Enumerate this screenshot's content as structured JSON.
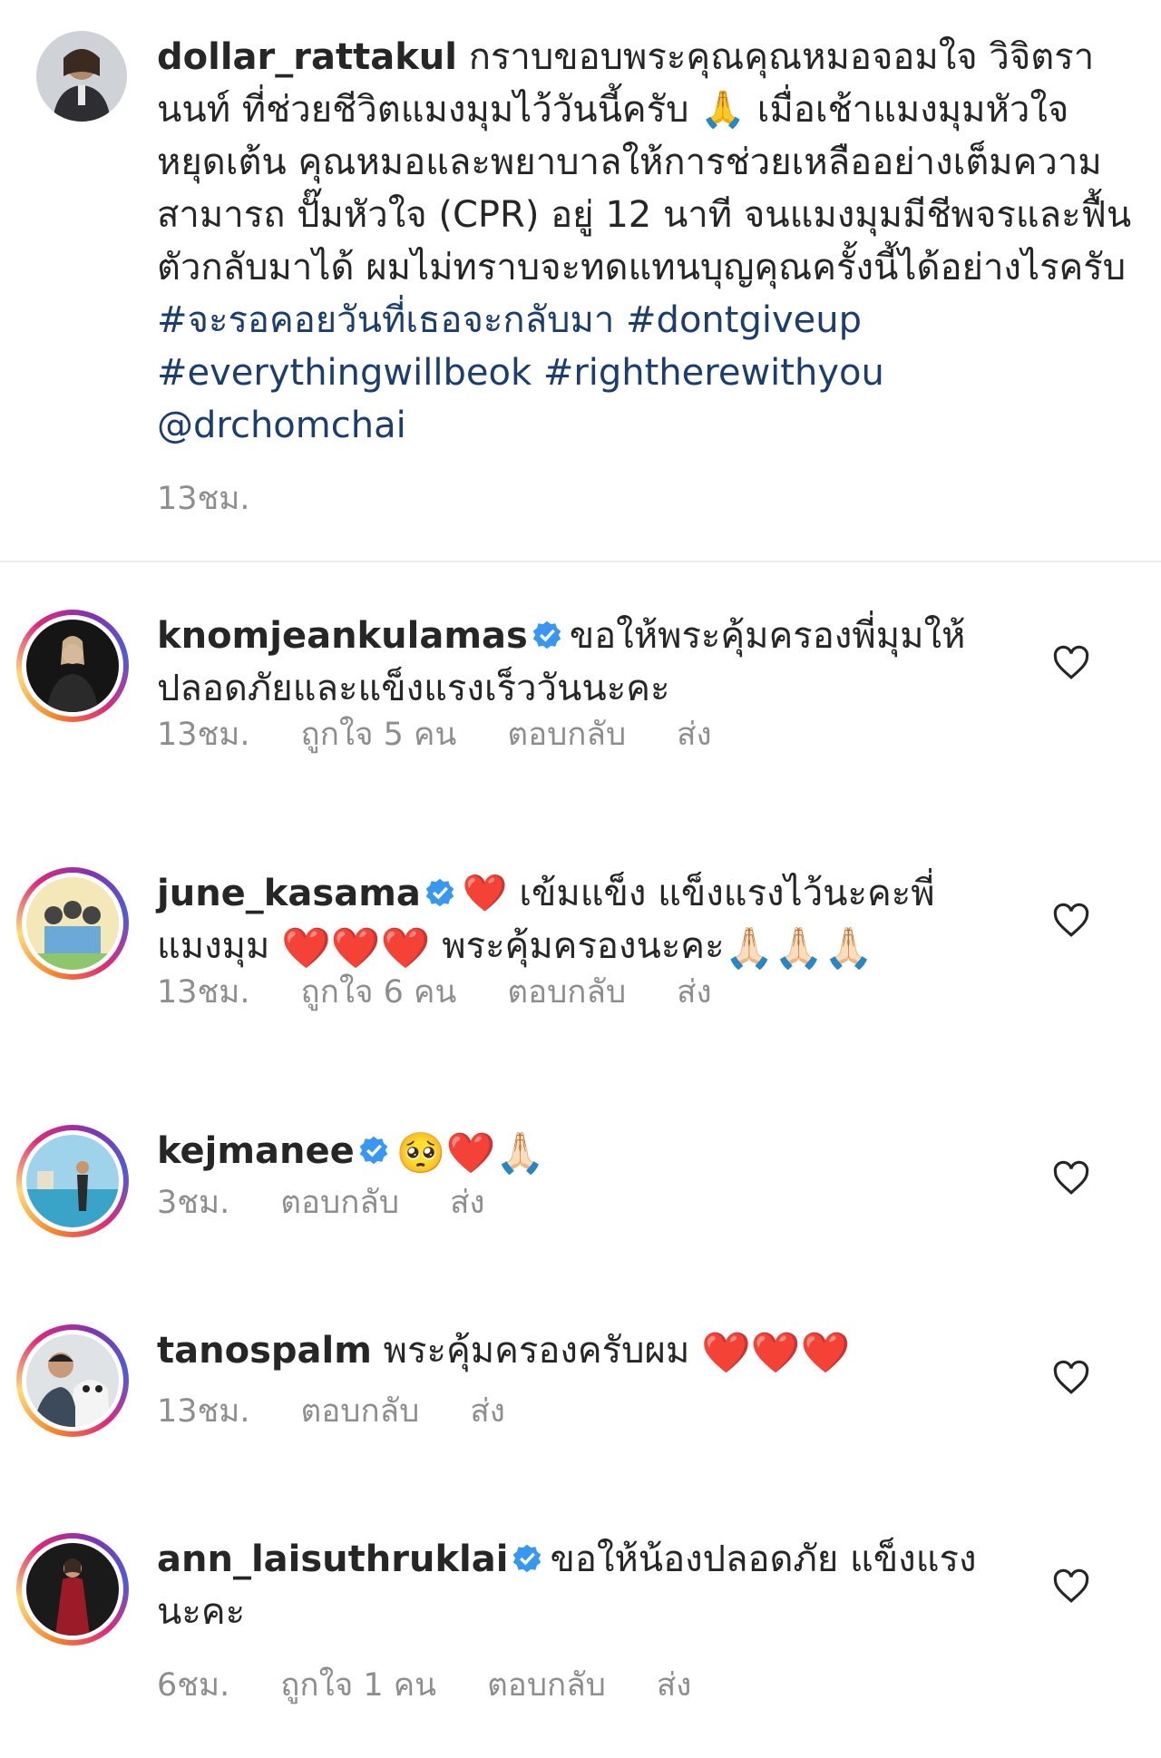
{
  "caption": {
    "username": "dollar_rattakul",
    "text": "กราบขอบพระคุณคุณหมอจอมใจ  วิจิตรานนท์ ที่ช่วยชีวิตแมงมุมไว้วันนี้ครับ 🙏 เมื่อเช้าแมงมุมหัวใจหยุดเต้น คุณหมอและพยาบาลให้การช่วยเหลืออย่างเต็มความสามารถ ปั๊มหัวใจ (CPR) อยู่ 12 นาที จนแมงมุมมีชีพจรและฟื้นตัวกลับมาได้ ผมไม่ทราบจะทดแทนบุญคุณครั้งนี้ได้อย่างไรครับ",
    "tags": "#จะรอคอยวันที่เธอจะกลับมา #dontgiveup #everythingwillbeok #rightherewithyou @drchomchai",
    "time": "13ชม."
  },
  "comments": [
    {
      "username": "knomjeankulamas",
      "text": "ขอให้พระคุ้มครองพี่มุมให้ปลอดภัยและแข็งแรงเร็ววันนะคะ",
      "time": "13ชม.",
      "likes": "ถูกใจ 5 คน",
      "reply": "ตอบกลับ",
      "send": "ส่ง"
    },
    {
      "username": "june_kasama",
      "text_a": "❤️ เข้มแข็ง แข็งแรงไว้นะคะพี่แมงมุม",
      "text_b": "❤️❤️❤️",
      "text_c": "พระคุ้มครองนะคะ",
      "text_d": "🙏🏻🙏🏻🙏🏻",
      "time": "13ชม.",
      "likes": "ถูกใจ 6 คน",
      "reply": "ตอบกลับ",
      "send": "ส่ง"
    },
    {
      "username": "kejmanee",
      "text": "🥺❤️🙏🏻",
      "time": "3ชม.",
      "reply": "ตอบกลับ",
      "send": "ส่ง"
    },
    {
      "username": "tanospalm",
      "text": "พระคุ้มครองครับผม",
      "hearts": "❤️❤️❤️",
      "time": "13ชม.",
      "reply": "ตอบกลับ",
      "send": "ส่ง"
    },
    {
      "username": "ann_laisuthruklai",
      "text": "ขอให้น้องปลอดภัย แข็งแรงนะคะ",
      "time": "6ชม.",
      "likes": "ถูกใจ 1 คน",
      "reply": "ตอบกลับ",
      "send": "ส่ง"
    }
  ],
  "colors": {
    "link": "#1c3e6e",
    "verified": "#3897f0",
    "muted": "#8e8e8e",
    "heart": "#e0282f"
  }
}
